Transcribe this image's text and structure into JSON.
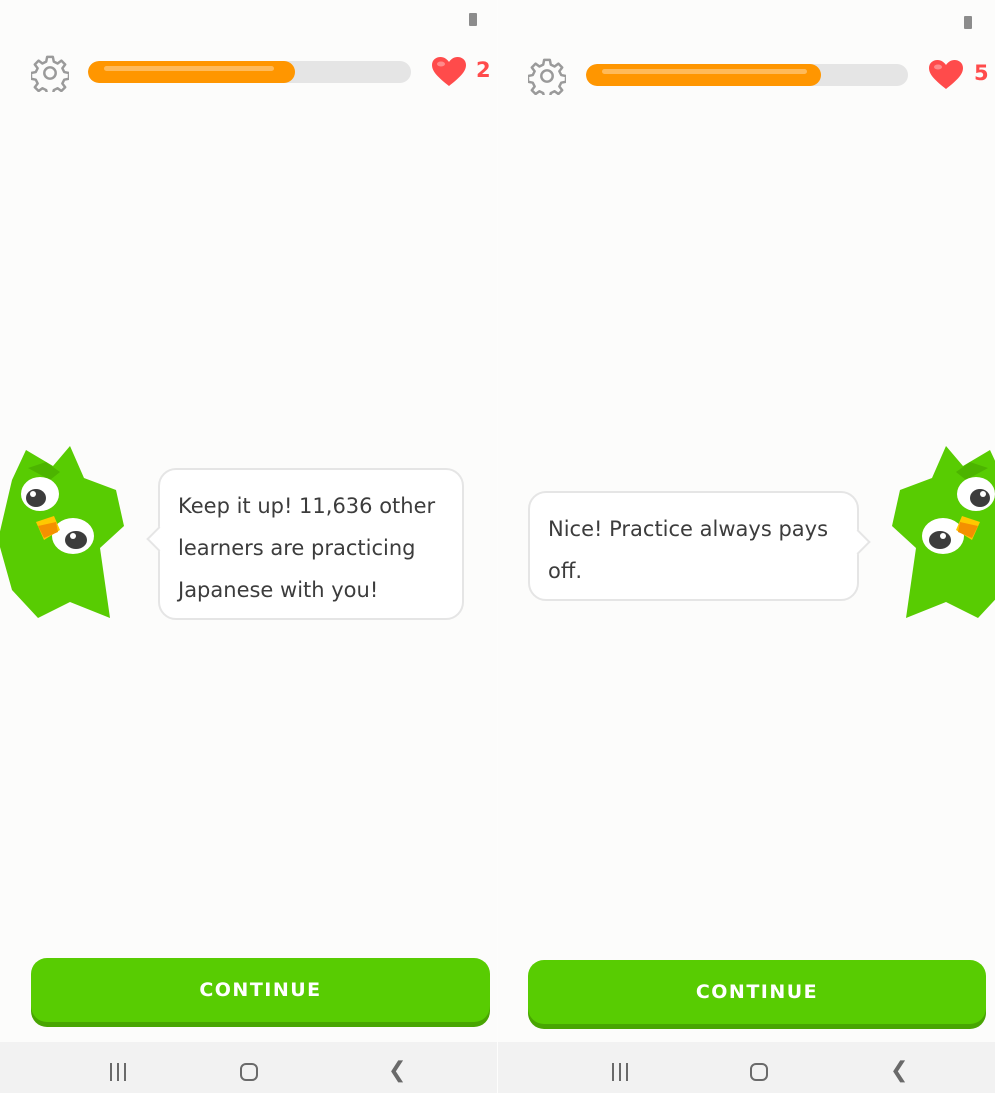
{
  "screens": [
    {
      "progress": 0.64,
      "hearts": "2",
      "message": "Keep it up! 11,636 other learners are practicing Japanese with you!",
      "button": "CONTINUE",
      "mascot_side": "left"
    },
    {
      "progress": 0.73,
      "hearts": "5",
      "message": "Nice! Practice always pays off.",
      "button": "CONTINUE",
      "mascot_side": "right"
    }
  ],
  "icons": {
    "settings": "gear-icon",
    "hearts": "heart-icon",
    "mascot": "owl-mascot",
    "nav": [
      "recent-apps-icon",
      "home-icon",
      "back-icon"
    ]
  },
  "colors": {
    "progress_fill": "#ff9600",
    "progress_track": "#e5e5e5",
    "heart": "#ff4b4b",
    "button": "#58cc02",
    "button_shadow": "#48a502",
    "mascot": "#58cc02",
    "text": "#3c3c3c"
  }
}
